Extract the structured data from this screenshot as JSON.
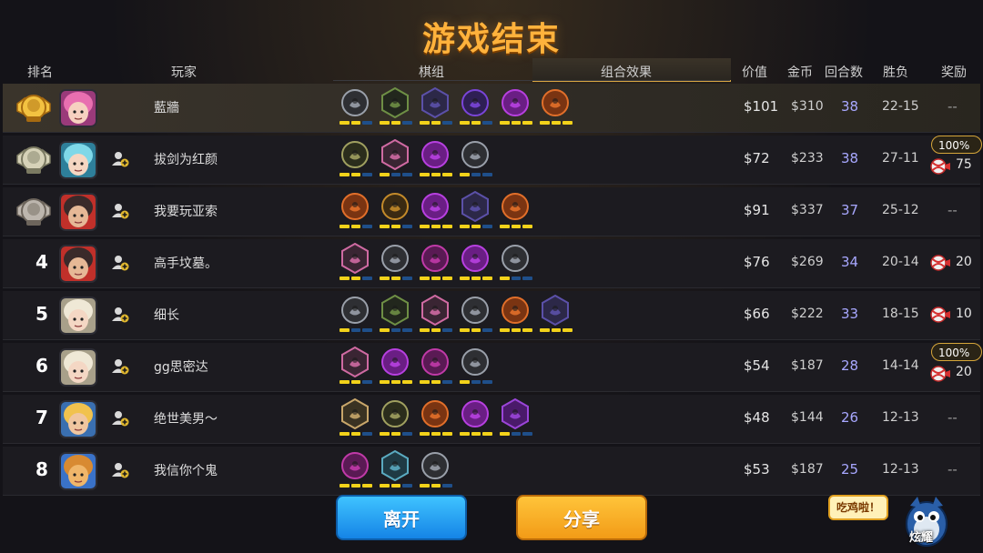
{
  "title": "游戏结束",
  "headers": {
    "rank": "排名",
    "player": "玩家",
    "lineup": "棋组",
    "synergy": "组合效果",
    "value": "价值",
    "gold": "金币",
    "rounds": "回合数",
    "winloss": "胜负",
    "reward": "奖励"
  },
  "colors": {
    "title": "#ffb23c",
    "rounds": "#a8a8ff",
    "pip_on": "#f2d21a",
    "pip_off": "#1f4f8a",
    "row_highlight": "#3a342b"
  },
  "rows": [
    {
      "rank": "1",
      "medal": "gold",
      "avatar": "pink-hair",
      "name": "藍牆",
      "value": "$101",
      "gold": "$310",
      "rounds": "38",
      "winloss": "22-15",
      "reward": "--",
      "bonus": "",
      "reward_amount": "",
      "traits": [
        {
          "icon": "gray-circle-icon",
          "bg": "#2e2f33",
          "ring": "#9aa0aa",
          "pips": [
            1,
            1,
            0
          ]
        },
        {
          "icon": "green-hex-icon",
          "bg": "#22271d",
          "ring": "#6e8f45",
          "pips": [
            1,
            1,
            0
          ]
        },
        {
          "icon": "purple-hat-icon",
          "bg": "#2c2848",
          "ring": "#5b50a8",
          "pips": [
            1,
            1,
            0
          ]
        },
        {
          "icon": "fish-bone-icon",
          "bg": "#2e1f55",
          "ring": "#7a45d8",
          "pips": [
            1,
            1,
            0
          ]
        },
        {
          "icon": "magenta-demon-icon",
          "bg": "#6a1e84",
          "ring": "#b740e0",
          "pips": [
            1,
            1,
            1
          ]
        },
        {
          "icon": "orange-horn-icon",
          "bg": "#7a3412",
          "ring": "#e16f2a",
          "pips": [
            1,
            1,
            1
          ]
        }
      ]
    },
    {
      "rank": "2",
      "medal": "silver",
      "avatar": "cyan-hair",
      "name": "拔剑为红颜",
      "value": "$72",
      "gold": "$233",
      "rounds": "38",
      "winloss": "27-11",
      "reward": "",
      "bonus": "100%",
      "reward_amount": "75",
      "traits": [
        {
          "icon": "olive-circle-icon",
          "bg": "#2b2d1c",
          "ring": "#a0a060",
          "pips": [
            1,
            1,
            0
          ]
        },
        {
          "icon": "pink-hex-icon",
          "bg": "#3a2533",
          "ring": "#cf6aa2",
          "pips": [
            1,
            0,
            0
          ]
        },
        {
          "icon": "magenta-demon-icon",
          "bg": "#6a1e84",
          "ring": "#b740e0",
          "pips": [
            1,
            1,
            1
          ]
        },
        {
          "icon": "gray-circle-icon",
          "bg": "#2e2f33",
          "ring": "#9aa0aa",
          "pips": [
            1,
            0,
            0
          ]
        }
      ]
    },
    {
      "rank": "3",
      "medal": "bronze",
      "avatar": "masked-red",
      "name": "我要玩亚索",
      "value": "$91",
      "gold": "$337",
      "rounds": "37",
      "winloss": "25-12",
      "reward": "--",
      "bonus": "",
      "reward_amount": "",
      "traits": [
        {
          "icon": "orange-horn-icon",
          "bg": "#7a3412",
          "ring": "#e16f2a",
          "pips": [
            1,
            1,
            0
          ]
        },
        {
          "icon": "gear-icon",
          "bg": "#3a2a12",
          "ring": "#c38a2a",
          "pips": [
            1,
            1,
            0
          ]
        },
        {
          "icon": "magenta-demon-icon",
          "bg": "#6a1e84",
          "ring": "#b740e0",
          "pips": [
            1,
            1,
            1
          ]
        },
        {
          "icon": "purple-hat-icon",
          "bg": "#2c2848",
          "ring": "#5b50a8",
          "pips": [
            1,
            1,
            0
          ]
        },
        {
          "icon": "orange-horn-icon",
          "bg": "#7a3412",
          "ring": "#e16f2a",
          "pips": [
            1,
            1,
            1
          ]
        }
      ]
    },
    {
      "rank": "4",
      "medal": "",
      "avatar": "masked-red",
      "name": "高手坟墓。",
      "value": "$76",
      "gold": "$269",
      "rounds": "34",
      "winloss": "20-14",
      "reward": "",
      "bonus": "",
      "reward_amount": "20",
      "traits": [
        {
          "icon": "pink-hex-icon",
          "bg": "#3a2533",
          "ring": "#cf6aa2",
          "pips": [
            1,
            1,
            0
          ]
        },
        {
          "icon": "gray-circle-icon",
          "bg": "#2e2f33",
          "ring": "#9aa0aa",
          "pips": [
            1,
            1,
            0
          ]
        },
        {
          "icon": "magenta-bolt-icon",
          "bg": "#5a1a54",
          "ring": "#c03aa8",
          "pips": [
            1,
            1,
            1
          ]
        },
        {
          "icon": "magenta-demon-icon",
          "bg": "#6a1e84",
          "ring": "#b740e0",
          "pips": [
            1,
            1,
            1
          ]
        },
        {
          "icon": "gray-circle-icon",
          "bg": "#2e2f33",
          "ring": "#9aa0aa",
          "pips": [
            1,
            0,
            0
          ]
        }
      ]
    },
    {
      "rank": "5",
      "medal": "",
      "avatar": "white-elf",
      "name": "细长",
      "value": "$66",
      "gold": "$222",
      "rounds": "33",
      "winloss": "18-15",
      "reward": "",
      "bonus": "",
      "reward_amount": "10",
      "traits": [
        {
          "icon": "gray-circle-icon",
          "bg": "#2e2f33",
          "ring": "#9aa0aa",
          "pips": [
            1,
            0,
            0
          ]
        },
        {
          "icon": "green-hex-icon",
          "bg": "#22271d",
          "ring": "#6e8f45",
          "pips": [
            1,
            0,
            0
          ]
        },
        {
          "icon": "pink-hex-icon",
          "bg": "#3a2533",
          "ring": "#cf6aa2",
          "pips": [
            1,
            1,
            0
          ]
        },
        {
          "icon": "gray-circle-icon",
          "bg": "#2e2f33",
          "ring": "#9aa0aa",
          "pips": [
            1,
            1,
            0
          ]
        },
        {
          "icon": "orange-horn-icon",
          "bg": "#7a3412",
          "ring": "#e16f2a",
          "pips": [
            1,
            1,
            1
          ]
        },
        {
          "icon": "purple-hat-icon",
          "bg": "#2c2848",
          "ring": "#5b50a8",
          "pips": [
            1,
            1,
            1
          ]
        }
      ]
    },
    {
      "rank": "6",
      "medal": "",
      "avatar": "white-elf",
      "name": "gg思密达",
      "value": "$54",
      "gold": "$187",
      "rounds": "28",
      "winloss": "14-14",
      "reward": "",
      "bonus": "100%",
      "reward_amount": "20",
      "traits": [
        {
          "icon": "pink-hex-icon",
          "bg": "#3a2533",
          "ring": "#cf6aa2",
          "pips": [
            1,
            1,
            0
          ]
        },
        {
          "icon": "magenta-demon-icon",
          "bg": "#6a1e84",
          "ring": "#b740e0",
          "pips": [
            1,
            1,
            1
          ]
        },
        {
          "icon": "magenta-bolt-icon",
          "bg": "#5a1a54",
          "ring": "#c03aa8",
          "pips": [
            1,
            1,
            0
          ]
        },
        {
          "icon": "gray-circle-icon",
          "bg": "#2e2f33",
          "ring": "#9aa0aa",
          "pips": [
            1,
            0,
            0
          ]
        }
      ]
    },
    {
      "rank": "7",
      "medal": "",
      "avatar": "blonde-hero",
      "name": "绝世美男～",
      "value": "$48",
      "gold": "$144",
      "rounds": "26",
      "winloss": "12-13",
      "reward": "--",
      "bonus": "",
      "reward_amount": "",
      "traits": [
        {
          "icon": "tan-claw-icon",
          "bg": "#3a3222",
          "ring": "#c8a66a",
          "pips": [
            1,
            1,
            0
          ]
        },
        {
          "icon": "olive-circle-icon",
          "bg": "#2b2d1c",
          "ring": "#a0a060",
          "pips": [
            1,
            1,
            0
          ]
        },
        {
          "icon": "orange-horn-icon",
          "bg": "#7a3412",
          "ring": "#e16f2a",
          "pips": [
            1,
            1,
            1
          ]
        },
        {
          "icon": "magenta-demon-icon",
          "bg": "#6a1e84",
          "ring": "#b740e0",
          "pips": [
            1,
            1,
            1
          ]
        },
        {
          "icon": "purple-shield-icon",
          "bg": "#4a1a6a",
          "ring": "#9a45d8",
          "pips": [
            1,
            0,
            0
          ]
        }
      ]
    },
    {
      "rank": "8",
      "medal": "",
      "avatar": "teddy-bear",
      "name": "我信你个鬼",
      "value": "$53",
      "gold": "$187",
      "rounds": "25",
      "winloss": "12-13",
      "reward": "--",
      "bonus": "",
      "reward_amount": "",
      "traits": [
        {
          "icon": "magenta-bolt-icon",
          "bg": "#5a1a54",
          "ring": "#c03aa8",
          "pips": [
            1,
            1,
            1
          ]
        },
        {
          "icon": "cyan-hex-icon",
          "bg": "#1f3a44",
          "ring": "#5aaac0",
          "pips": [
            1,
            1,
            0
          ]
        },
        {
          "icon": "gray-circle-icon",
          "bg": "#2e2f33",
          "ring": "#9aa0aa",
          "pips": [
            1,
            1,
            0
          ]
        }
      ]
    }
  ],
  "buttons": {
    "leave": "离开",
    "share": "分享"
  },
  "bubble_text": "吃鸡啦！",
  "mascot_label": "炫耀"
}
